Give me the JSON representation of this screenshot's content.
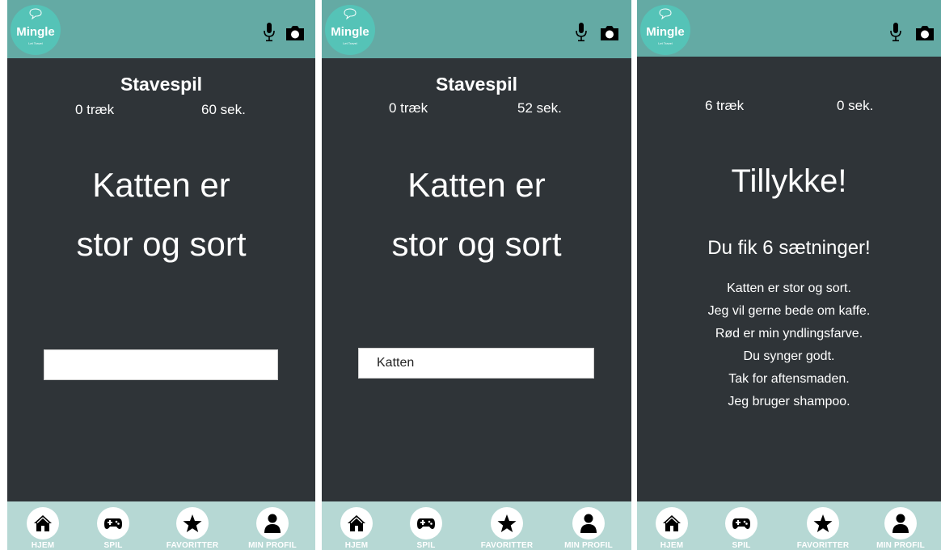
{
  "app": {
    "logo_name": "Mingle",
    "logo_tagline": "Let Travel"
  },
  "nav": [
    {
      "label": "HJEM",
      "icon": "home-icon"
    },
    {
      "label": "SPIL",
      "icon": "gamepad-icon"
    },
    {
      "label": "FAVORITTER",
      "icon": "star-icon"
    },
    {
      "label": "MIN PROFIL",
      "icon": "person-icon"
    }
  ],
  "screens": [
    {
      "title": "Stavespil",
      "moves": "0 træk",
      "seconds": "60 sek.",
      "sentence_line1": "Katten er",
      "sentence_line2": "stor og sort",
      "input_value": ""
    },
    {
      "title": "Stavespil",
      "moves": "0 træk",
      "seconds": "52 sek.",
      "sentence_line1": "Katten er",
      "sentence_line2": "stor og sort",
      "input_value": "Katten"
    },
    {
      "moves": "6 træk",
      "seconds": "0 sek.",
      "congrats": "Tillykke!",
      "summary": "Du fik 6 sætninger!",
      "sentences": [
        "Katten er stor og sort.",
        "Jeg vil gerne bede om kaffe.",
        "Rød er min yndlingsfarve.",
        "Du synger godt.",
        "Tak for aftensmaden.",
        "Jeg bruger shampoo."
      ]
    }
  ],
  "colors": {
    "header": "#64aaa4",
    "body": "#2f3438",
    "nav": "#b6d8d4",
    "logo": "#55c3b7"
  }
}
